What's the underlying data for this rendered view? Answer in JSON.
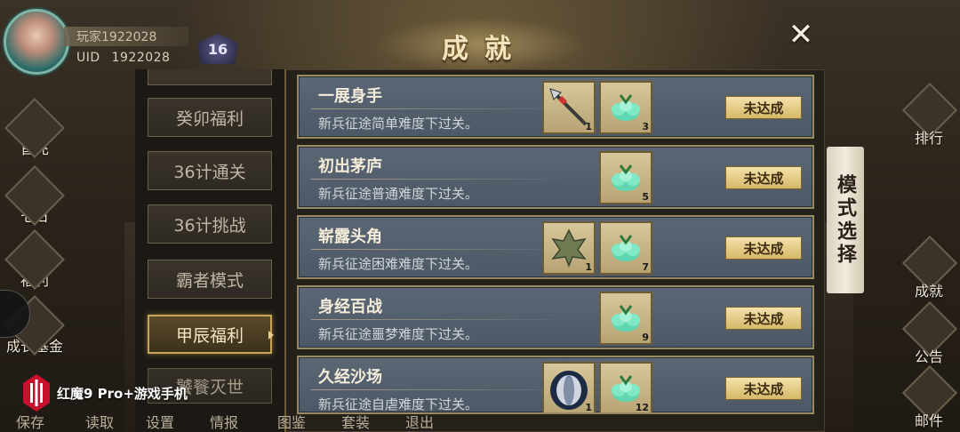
{
  "player": {
    "name": "玩家1922028",
    "uid_label": "UID",
    "uid": "1922028",
    "level": "16"
  },
  "window": {
    "title": "成就",
    "close_icon": "close-icon"
  },
  "sidebar": {
    "tabs": [
      {
        "label": "癸卯福利",
        "active": false
      },
      {
        "label": "36计通关",
        "active": false
      },
      {
        "label": "36计挑战",
        "active": false
      },
      {
        "label": "霸者模式",
        "active": false
      },
      {
        "label": "甲辰福利",
        "active": true
      },
      {
        "label": "饕餮灭世",
        "active": false
      }
    ]
  },
  "achievements": [
    {
      "name": "一展身手",
      "desc": "新兵征途简单难度下过关。",
      "status": "未达成",
      "rewards": [
        {
          "icon": "spear-icon",
          "count": "1"
        },
        {
          "icon": "jade-gem-icon",
          "count": "3"
        }
      ]
    },
    {
      "name": "初出茅庐",
      "desc": "新兵征途普通难度下过关。",
      "status": "未达成",
      "rewards": [
        {
          "icon": "jade-gem-icon",
          "count": "5"
        }
      ]
    },
    {
      "name": "崭露头角",
      "desc": "新兵征途困难难度下过关。",
      "status": "未达成",
      "rewards": [
        {
          "icon": "leaf-icon",
          "count": "1"
        },
        {
          "icon": "jade-gem-icon",
          "count": "7"
        }
      ]
    },
    {
      "name": "身经百战",
      "desc": "新兵征途噩梦难度下过关。",
      "status": "未达成",
      "rewards": [
        {
          "icon": "jade-gem-icon",
          "count": "9"
        }
      ]
    },
    {
      "name": "久经沙场",
      "desc": "新兵征途自虐难度下过关。",
      "status": "未达成",
      "rewards": [
        {
          "icon": "helmet-icon",
          "count": "1"
        },
        {
          "icon": "jade-gem-icon",
          "count": "12"
        }
      ]
    }
  ],
  "left_menu": [
    "首充",
    "七日",
    "福利",
    "成长基金"
  ],
  "right_menu": [
    "排行",
    "成就",
    "公告",
    "邮件"
  ],
  "bottom_bar": [
    "保存",
    "读取",
    "设置",
    "情报",
    "图鉴",
    "套装",
    "退出"
  ],
  "side_scroll": "模式选择",
  "watermark": "红魔9 Pro+游戏手机",
  "colors": {
    "row_bg": "#56626f",
    "row_border": "#9a8a62",
    "status_button": "#e6cc86",
    "active_tab_border": "#c9a55a"
  }
}
